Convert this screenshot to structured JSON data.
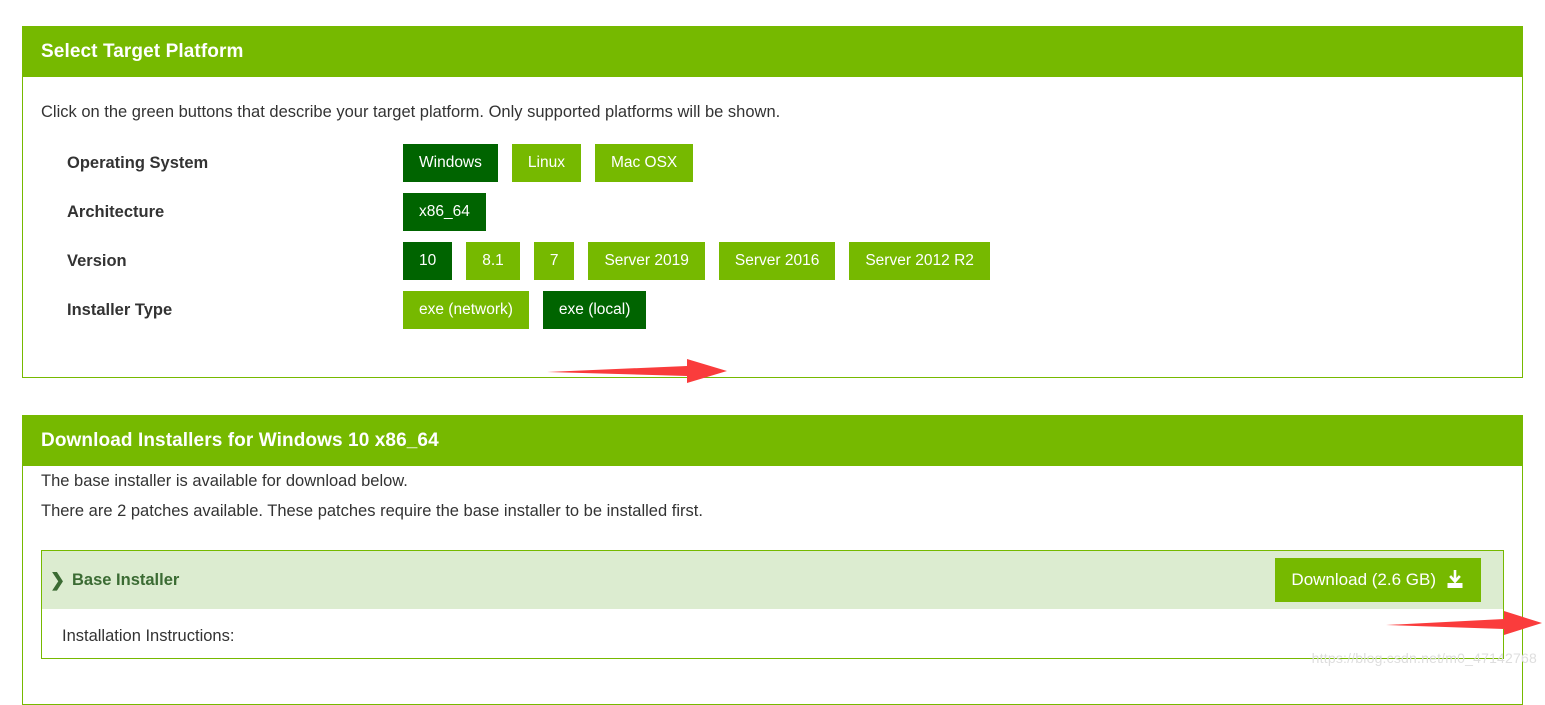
{
  "select_platform": {
    "header": "Select Target Platform",
    "intro": "Click on the green buttons that describe your target platform. Only supported platforms will be shown.",
    "rows": [
      {
        "label": "Operating System",
        "name": "operating-system",
        "options": [
          {
            "label": "Windows",
            "selected": true
          },
          {
            "label": "Linux",
            "selected": false
          },
          {
            "label": "Mac OSX",
            "selected": false
          }
        ]
      },
      {
        "label": "Architecture",
        "name": "architecture",
        "options": [
          {
            "label": "x86_64",
            "selected": true
          }
        ]
      },
      {
        "label": "Version",
        "name": "version",
        "options": [
          {
            "label": "10",
            "selected": true
          },
          {
            "label": "8.1",
            "selected": false
          },
          {
            "label": "7",
            "selected": false
          },
          {
            "label": "Server 2019",
            "selected": false
          },
          {
            "label": "Server 2016",
            "selected": false
          },
          {
            "label": "Server 2012 R2",
            "selected": false
          }
        ]
      },
      {
        "label": "Installer Type",
        "name": "installer-type",
        "options": [
          {
            "label": "exe (network)",
            "selected": false
          },
          {
            "label": "exe (local)",
            "selected": true
          }
        ]
      }
    ]
  },
  "download_section": {
    "header": "Download Installers for Windows 10 x86_64",
    "line1": "The base installer is available for download below.",
    "line2": "There are 2 patches available. These patches require the base installer to be installed first.",
    "base_installer": {
      "chevron": "❯",
      "title": "Base Installer",
      "download_label": "Download (2.6 GB)",
      "download_icon": "download-icon",
      "instructions_label": "Installation Instructions:"
    }
  },
  "annotations": {
    "arrow_color": "#fa3c3c",
    "arrow_installer": "red-arrow-installer-type",
    "arrow_download": "red-arrow-download-button"
  },
  "watermark": "https://blog.csdn.net/m0_47142768",
  "colors": {
    "brand_green": "#76b900",
    "selected_green": "#006400",
    "installer_head_bg": "#dcecd0",
    "text": "#333333"
  }
}
